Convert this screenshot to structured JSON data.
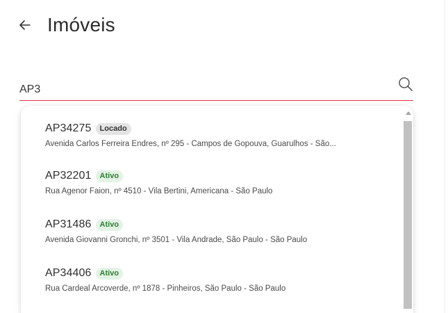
{
  "header": {
    "back_icon": "arrow-left-icon",
    "title": "Imóveis"
  },
  "search": {
    "value": "AP3",
    "icon": "search-icon"
  },
  "results": [
    {
      "code": "AP34275",
      "status": "Locado",
      "address": "Avenida Carlos Ferreira Endres, nº 295 - Campos de Gopouva, Guarulhos - São..."
    },
    {
      "code": "AP32201",
      "status": "Ativo",
      "address": "Rua Agenor Faion, nº 4510 - Vila Bertini, Americana - São Paulo"
    },
    {
      "code": "AP31486",
      "status": "Ativo",
      "address": "Avenida Giovanni Gronchi, nº 3501 - Vila Andrade, São Paulo - São Paulo"
    },
    {
      "code": "AP34406",
      "status": "Ativo",
      "address": "Rua Cardeal Arcoverde, nº 1878 - Pinheiros, São Paulo - São Paulo"
    }
  ],
  "colors": {
    "accent_underline": "#e0304a",
    "badge_locado_bg": "#e4e4e4",
    "badge_ativo_bg": "#e3f3e4",
    "badge_ativo_text": "#2e7d32"
  }
}
